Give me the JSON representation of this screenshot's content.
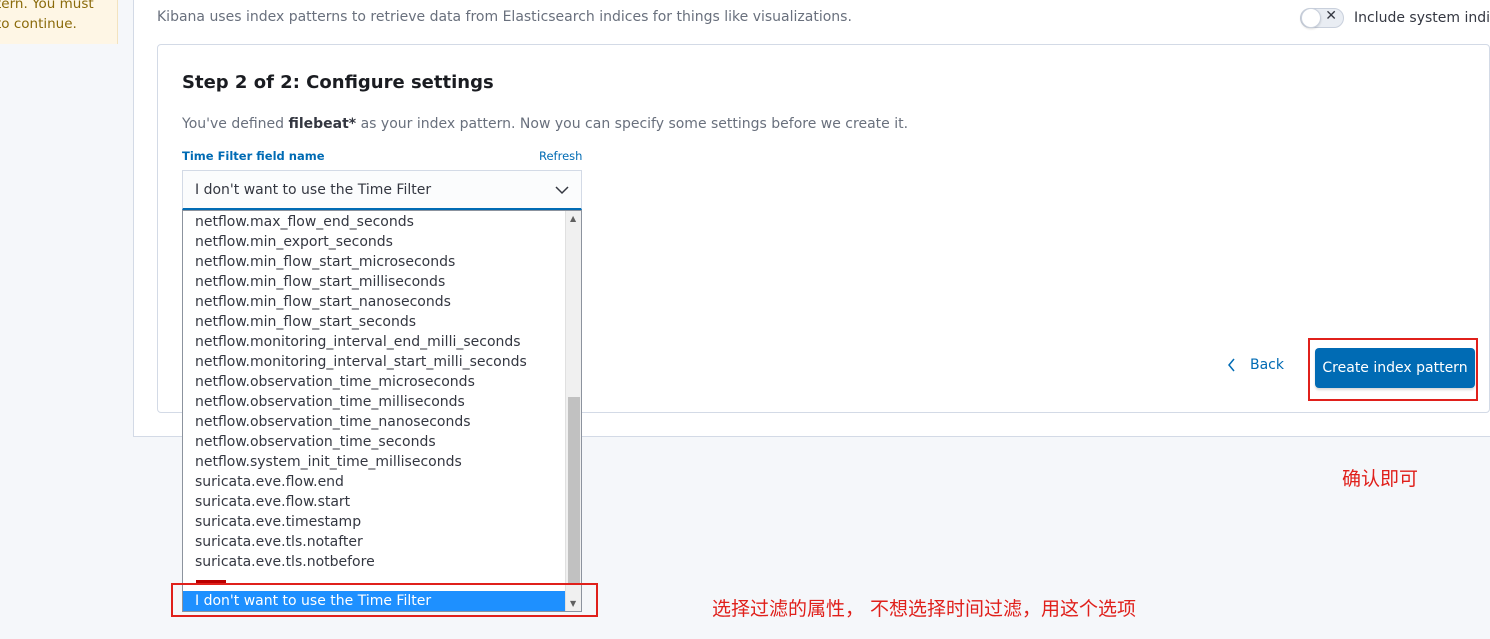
{
  "callout": {
    "line1": "tern. You must",
    "line2": "to continue."
  },
  "header": {
    "description": "Kibana uses index patterns to retrieve data from Elasticsearch indices for things like visualizations.",
    "system_toggle_label": "Include system indice"
  },
  "step": {
    "title": "Step 2 of 2: Configure settings",
    "desc_prefix": "You've defined ",
    "pattern": "filebeat*",
    "desc_suffix": " as your index pattern. Now you can specify some settings before we create it."
  },
  "time_field": {
    "label": "Time Filter field name",
    "refresh": "Refresh",
    "selected": "I don't want to use the Time Filter",
    "options": [
      "netflow.max_flow_end_seconds",
      "netflow.min_export_seconds",
      "netflow.min_flow_start_microseconds",
      "netflow.min_flow_start_milliseconds",
      "netflow.min_flow_start_nanoseconds",
      "netflow.min_flow_start_seconds",
      "netflow.monitoring_interval_end_milli_seconds",
      "netflow.monitoring_interval_start_milli_seconds",
      "netflow.observation_time_microseconds",
      "netflow.observation_time_milliseconds",
      "netflow.observation_time_nanoseconds",
      "netflow.observation_time_seconds",
      "netflow.system_init_time_milliseconds",
      "suricata.eve.flow.end",
      "suricata.eve.flow.start",
      "suricata.eve.timestamp",
      "suricata.eve.tls.notafter",
      "suricata.eve.tls.notbefore"
    ],
    "highlighted_option": "I don't want to use the Time Filter"
  },
  "actions": {
    "back": "Back",
    "create": "Create index pattern"
  },
  "annotations": {
    "confirm": "确认即可",
    "choose": "选择过滤的属性， 不想选择时间过滤，用这个选项"
  },
  "colors": {
    "primary": "#006bb4",
    "annotation_red": "#e0201b",
    "highlight": "#1e90ff"
  }
}
